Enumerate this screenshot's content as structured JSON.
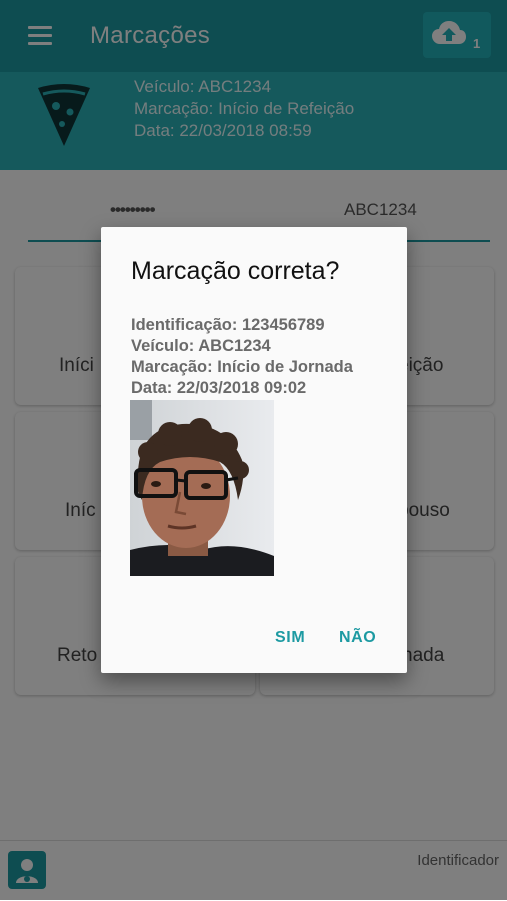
{
  "appbar": {
    "title": "Marcações",
    "upload_count": "1"
  },
  "info": {
    "vehicle": "Veículo: ABC1234",
    "marking": "Marcação: Início de Refeição",
    "date": "Data: 22/03/2018 08:59"
  },
  "tabs": [
    {
      "label": "•••••••••"
    },
    {
      "label": "ABC1234"
    }
  ],
  "cards": [
    {
      "label": "Início de Jornada"
    },
    {
      "label": "Início de Refeição"
    },
    {
      "label": "Início de Descanso"
    },
    {
      "label": "Fim de Repouso"
    },
    {
      "label": "Retorno"
    },
    {
      "label": "Fim de Jornada"
    }
  ],
  "card_visible": [
    "Iníci",
    "eição",
    "Iníc",
    "pouso",
    "Reto",
    "nada"
  ],
  "bottom": {
    "identifier_label": "Identificador"
  },
  "dialog": {
    "title": "Marcação correta?",
    "identification": "Identificação: 123456789",
    "vehicle": "Veículo: ABC1234",
    "marking": "Marcação: Início de Jornada",
    "date": "Data: 22/03/2018 09:02",
    "confirm": "SIM",
    "cancel": "NÃO"
  },
  "colors": {
    "primary": "#1d9aa2",
    "band": "#2ab2b9",
    "accent_button": "#23b2ba"
  },
  "icons": [
    "menu-icon",
    "cloud-upload-icon",
    "pizza-icon",
    "user-icon"
  ]
}
